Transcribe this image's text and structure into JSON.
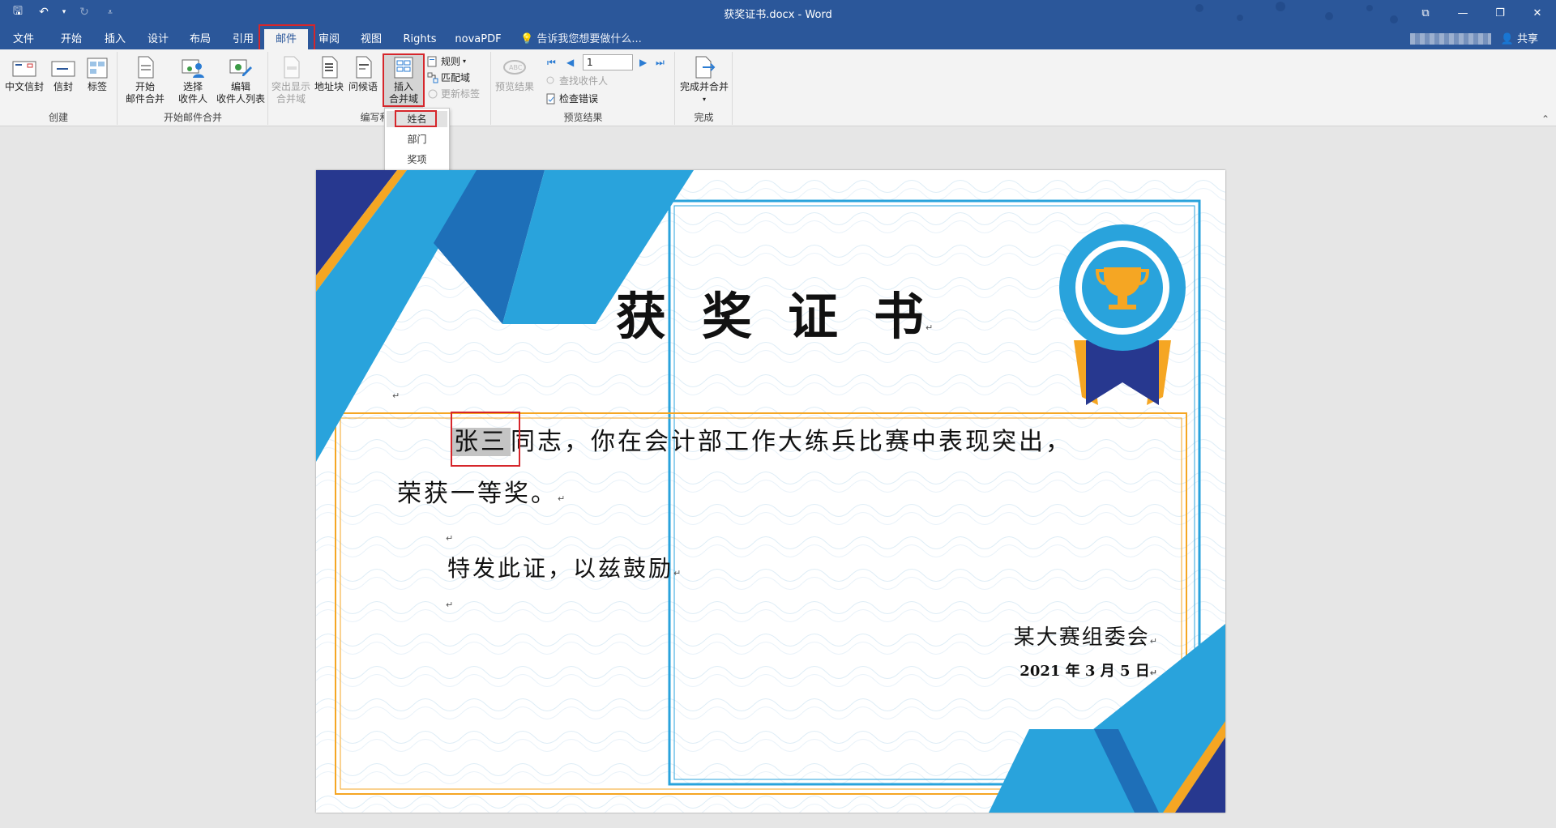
{
  "window": {
    "title": "获奖证书.docx - Word",
    "controls": {
      "restore": "⧉",
      "minimize": "—",
      "maximize": "❐",
      "close": "✕"
    }
  },
  "quick_access": {
    "save": "🖫",
    "undo": "↶",
    "undo_arrow": "▾",
    "redo": "↻",
    "customize": "⩡"
  },
  "tabs": [
    "文件",
    "开始",
    "插入",
    "设计",
    "布局",
    "引用",
    "邮件",
    "审阅",
    "视图",
    "Rights",
    "novaPDF"
  ],
  "active_tab": "邮件",
  "tell_me": "告诉我您想要做什么...",
  "share": "共享",
  "ribbon": {
    "groups": {
      "create": "创建",
      "start": "开始邮件合并",
      "write": "编写和插",
      "preview": "预览结果",
      "finish": "完成"
    },
    "buttons": {
      "envelope_cn": "中文信封",
      "envelope": "信封",
      "label": "标签",
      "start_merge_1": "开始",
      "start_merge_2": "邮件合并",
      "select_recipients_1": "选择",
      "select_recipients_2": "收件人",
      "edit_list_1": "编辑",
      "edit_list_2": "收件人列表",
      "highlight_1": "突出显示",
      "highlight_2": "合并域",
      "address_block": "地址块",
      "greeting": "问候语",
      "insert_field_1": "插入",
      "insert_field_2": "合并域",
      "rules": "规则",
      "match_fields": "匹配域",
      "update_labels": "更新标签",
      "preview_results": "预览结果",
      "record_number": "1",
      "find_recipient": "查找收件人",
      "check_errors": "检查错误",
      "finish_merge": "完成并合并"
    }
  },
  "dropdown": {
    "items": [
      "姓名",
      "部门",
      "奖项"
    ],
    "selected": "姓名"
  },
  "certificate": {
    "title": "获奖证书",
    "name_field": "张三",
    "line1": "同志，你在会计部工作大练兵比赛中表现突出，",
    "line2": "荣获一等奖。",
    "line3": "特发此证，以兹鼓励",
    "org": "某大赛组委会",
    "date": "2021 年 3 月 5 日",
    "para_mark": "↵"
  },
  "colors": {
    "word_blue": "#2b579a",
    "cert_blue": "#29a3dc",
    "cert_navy": "#27388f",
    "cert_orange": "#f5a623",
    "highlight_red": "#d6262b"
  }
}
